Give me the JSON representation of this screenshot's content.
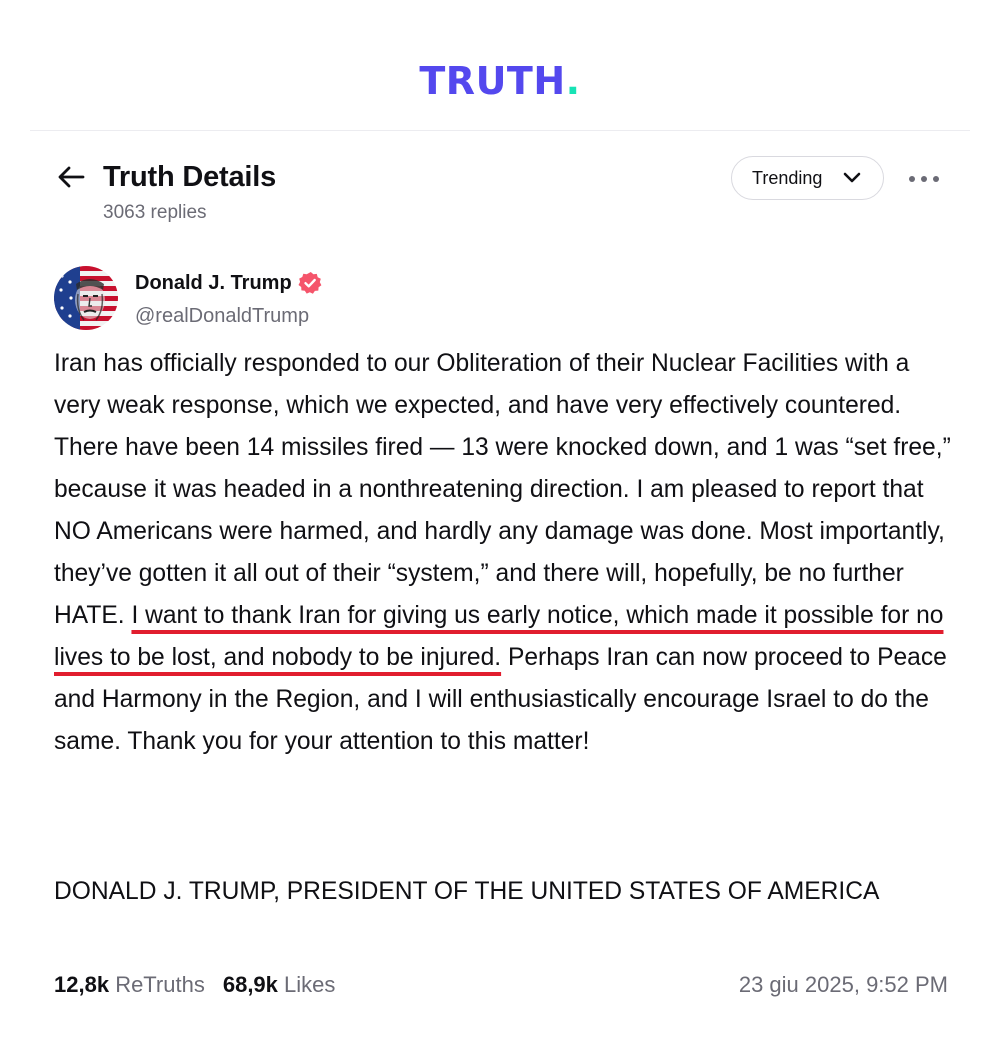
{
  "brand": {
    "logo_text": "TRUTH",
    "logo_dot": ".",
    "primary_color": "#5448ee",
    "accent_color": "#17e3b5"
  },
  "header": {
    "back_icon": "arrow-left-icon",
    "title": "Truth Details",
    "replies": "3063 replies",
    "sort_label": "Trending",
    "sort_icon": "chevron-down-icon",
    "more_icon": "more-horizontal-icon"
  },
  "post": {
    "author": {
      "name": "Donald J. Trump",
      "handle": "@realDonaldTrump",
      "verified_icon": "verified-badge-icon",
      "verified_color": "#f5556b"
    },
    "body_before": "Iran has officially responded to our Obliteration of their Nuclear Facilities with a very weak response, which we expected, and have very effectively countered. There have been 14 missiles fired — 13 were knocked down, and 1 was “set free,” because it was headed in a nonthreatening direction. I am pleased to report that NO Americans were harmed, and hardly any damage was done. Most importantly, they’ve gotten it all out of their “system,” and there will, hopefully, be no further HATE.",
    "body_highlight": "I want to thank Iran for giving us early notice, which made it possible for no lives to be lost, and nobody to be injured.",
    "body_after": "Perhaps Iran can now proceed to Peace and Harmony in the Region, and I will enthusiastically encourage Israel to do the same. Thank you for your attention to this matter!",
    "highlight_color": "#e11d2e",
    "signature": "DONALD J. TRUMP, PRESIDENT OF THE UNITED STATES OF AMERICA",
    "stats": {
      "retruths_count": "12,8k",
      "retruths_label": "ReTruths",
      "likes_count": "68,9k",
      "likes_label": "Likes"
    },
    "timestamp": "23 giu 2025, 9:52 PM"
  }
}
